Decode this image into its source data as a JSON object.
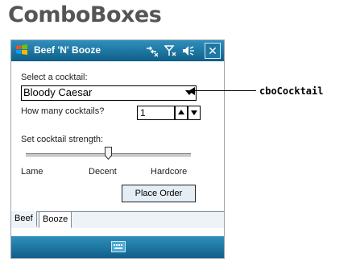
{
  "heading": "ComboBoxes",
  "window": {
    "title": "Beef 'N' Booze",
    "icons": [
      "windows-start-icon",
      "connectivity-icon",
      "signal-icon",
      "volume-icon",
      "close-icon"
    ],
    "close_label": "✕"
  },
  "form": {
    "cocktail_label": "Select a cocktail:",
    "cocktail_value": "Bloody Caesar",
    "quantity_label": "How many cocktails?",
    "quantity_value": "1",
    "strength_label": "Set cocktail strength:",
    "strength_level": 0.5,
    "strength_ticks": [
      "Lame",
      "Decent",
      "Hardcore"
    ],
    "order_button": "Place Order"
  },
  "tabs": [
    {
      "label": "Beef",
      "selected": false
    },
    {
      "label": "Booze",
      "selected": true
    }
  ],
  "annotation": {
    "text": "cboCocktail"
  },
  "colors": {
    "titlebar": "#1f77a3",
    "heading": "#555555",
    "tab_background": "#eef3f7"
  }
}
